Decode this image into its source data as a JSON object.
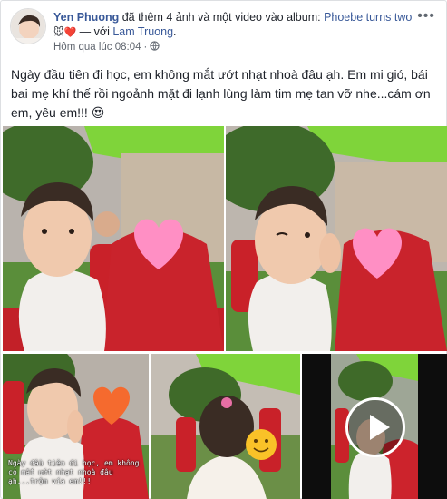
{
  "post": {
    "author": "Yen Phuong",
    "action_text": " đã thêm 4 ảnh và một video vào album: ",
    "album_name": "Phoebe turns two",
    "album_emoji": "🐭❤️",
    "with_text": " — với ",
    "tagged_person": "Lam Truong",
    "tagged_end": ".",
    "timestamp": "Hôm qua lúc 08:04",
    "timestamp_sep": "·",
    "privacy_icon": "globe-icon",
    "options_icon": "more-options-icon",
    "caption": "Ngày đầu tiên đi học, em không mắt ướt nhạt nhoà đâu ạh. Em mi gió, bái bai mẹ khí thế rồi ngoảnh mặt đi lạnh lùng làm tim mẹ tan vỡ nhe...cám ơn em, yêu em!!!",
    "caption_emoji": "😍",
    "photo_overlay_text": "Ngày đầu tiên đi học, em không có mắt ướt nhạt nhoà đâu ạh...trộm vía em!!!",
    "video_icon": "play-icon"
  },
  "colors": {
    "link": "#385898",
    "meta": "#616770",
    "heart": "#ff8fc4",
    "awning": "#7fd43a",
    "shirt": "#d0202a"
  }
}
